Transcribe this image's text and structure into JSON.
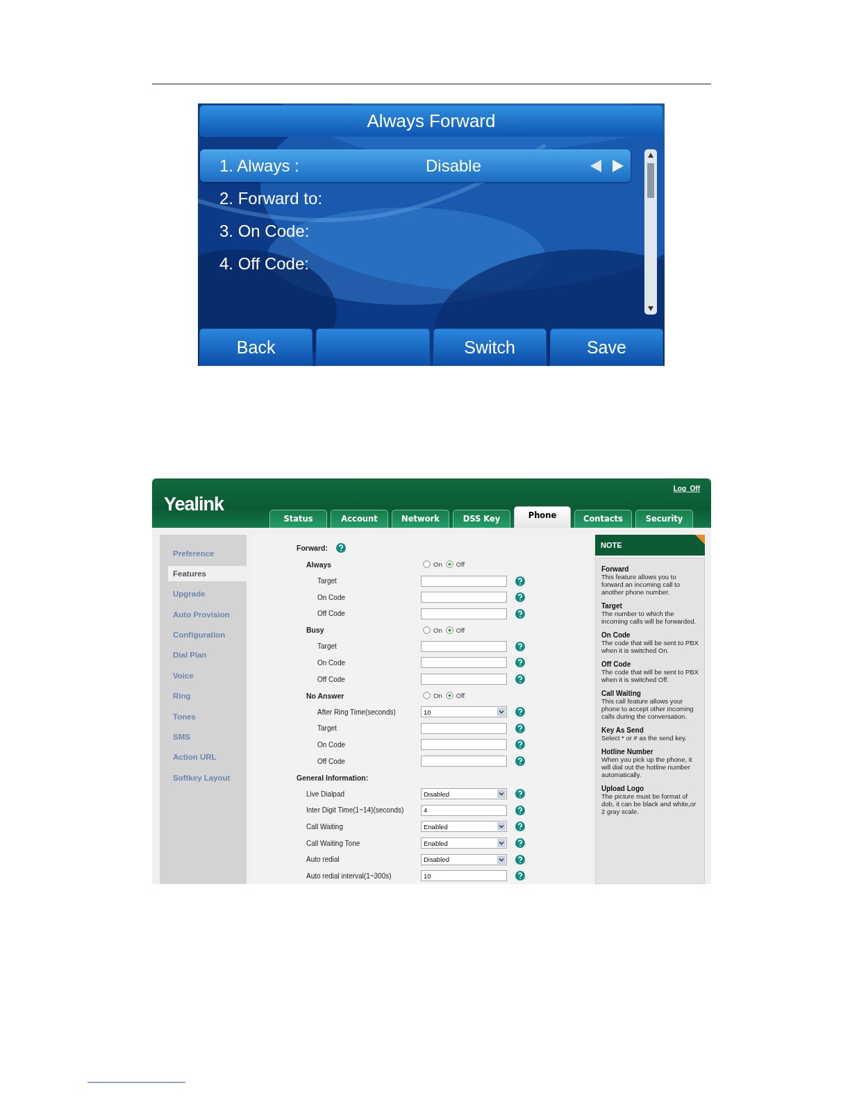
{
  "phone_screen": {
    "title": "Always Forward",
    "rows": [
      {
        "label": "1. Always :",
        "value": "Disable",
        "selected": true
      },
      {
        "label": "2. Forward to:",
        "selected": false
      },
      {
        "label": "3. On Code:",
        "selected": false
      },
      {
        "label": "4. Off Code:",
        "selected": false
      }
    ],
    "softkeys": [
      {
        "kind": "key",
        "label": "Back"
      },
      {
        "kind": "blank"
      },
      {
        "kind": "key",
        "label": "Switch"
      },
      {
        "kind": "key",
        "label": "Save"
      }
    ]
  },
  "web_ui": {
    "logo": "Yealink",
    "logout": "Log  Off",
    "tabs": [
      {
        "label": "Status",
        "selected": false
      },
      {
        "label": "Account",
        "selected": false
      },
      {
        "label": "Network",
        "selected": false
      },
      {
        "label": "DSS Key",
        "selected": false
      },
      {
        "label": "Phone",
        "selected": true
      },
      {
        "label": "Contacts",
        "selected": false
      },
      {
        "label": "Security",
        "selected": false
      }
    ],
    "sidebar": [
      {
        "label": "Preference",
        "selected": false
      },
      {
        "label": "Features",
        "selected": true
      },
      {
        "label": "Upgrade",
        "selected": false
      },
      {
        "label": "Auto Provision",
        "selected": false
      },
      {
        "label": "Configuration",
        "selected": false
      },
      {
        "label": "Dial Plan",
        "selected": false
      },
      {
        "label": "Voice",
        "selected": false
      },
      {
        "label": "Ring",
        "selected": false
      },
      {
        "label": "Tones",
        "selected": false
      },
      {
        "label": "SMS",
        "selected": false
      },
      {
        "label": "Action URL",
        "selected": false
      },
      {
        "label": "Softkey Layout",
        "selected": false
      }
    ],
    "forward": {
      "label": "Forward:",
      "groups": [
        {
          "label": "Always",
          "options": [
            {
              "label": "On",
              "selected": false
            },
            {
              "label": "Off",
              "selected": true
            }
          ],
          "fields": [
            {
              "kind": "input",
              "label": "Target"
            },
            {
              "kind": "input",
              "label": "On Code"
            },
            {
              "kind": "input",
              "label": "Off Code"
            }
          ]
        },
        {
          "label": "Busy",
          "options": [
            {
              "label": "On",
              "selected": false
            },
            {
              "label": "Off",
              "selected": true
            }
          ],
          "fields": [
            {
              "kind": "input",
              "label": "Target"
            },
            {
              "kind": "input",
              "label": "On Code"
            },
            {
              "kind": "input",
              "label": "Off Code"
            }
          ]
        },
        {
          "label": "No Answer",
          "options": [
            {
              "label": "On",
              "selected": false
            },
            {
              "label": "Off",
              "selected": true
            }
          ],
          "fields": [
            {
              "kind": "select",
              "label": "After Ring Time(seconds)",
              "value": "10"
            },
            {
              "kind": "input",
              "label": "Target"
            },
            {
              "kind": "input",
              "label": "On Code"
            },
            {
              "kind": "input",
              "label": "Off Code"
            }
          ]
        }
      ]
    },
    "general": {
      "label": "General Information:",
      "fields": [
        {
          "kind": "select",
          "label": "Live Dialpad",
          "value": "Disabled"
        },
        {
          "kind": "input",
          "label": "Inter Digit Time(1~14)(seconds)",
          "value": "4"
        },
        {
          "kind": "select",
          "label": "Call Waiting",
          "value": "Enabled"
        },
        {
          "kind": "select",
          "label": "Call Waiting Tone",
          "value": "Enabled"
        },
        {
          "kind": "select",
          "label": "Auto redial",
          "value": "Disabled"
        },
        {
          "kind": "input",
          "label": "Auto redial interval(1~300s)",
          "value": "10"
        }
      ]
    },
    "note": {
      "title": "NOTE",
      "entries": [
        {
          "title": "Forward",
          "text": "This feature allows you to forward an incoming call to another phone number."
        },
        {
          "title": "Target",
          "text": "The number to which the incoming calls will be forwarded."
        },
        {
          "title": "On Code",
          "text": "The code that will be sent to PBX when it is switched On."
        },
        {
          "title": "Off Code",
          "text": "The code that will be sent to PBX when it is switched Off."
        },
        {
          "title": "Call Waiting",
          "text": "This call feature allows your phone to accept other incoming calls during the conversation."
        },
        {
          "title": "Key As Send",
          "text": "Select * or # as the send key."
        },
        {
          "title": "Hotline Number",
          "text": "When you pick up the phone, it will dial out the hotline number automatically."
        },
        {
          "title": "Upload Logo",
          "text": "The picture must be format of dob, it can be black and white,or 2 gray scale."
        }
      ]
    }
  }
}
